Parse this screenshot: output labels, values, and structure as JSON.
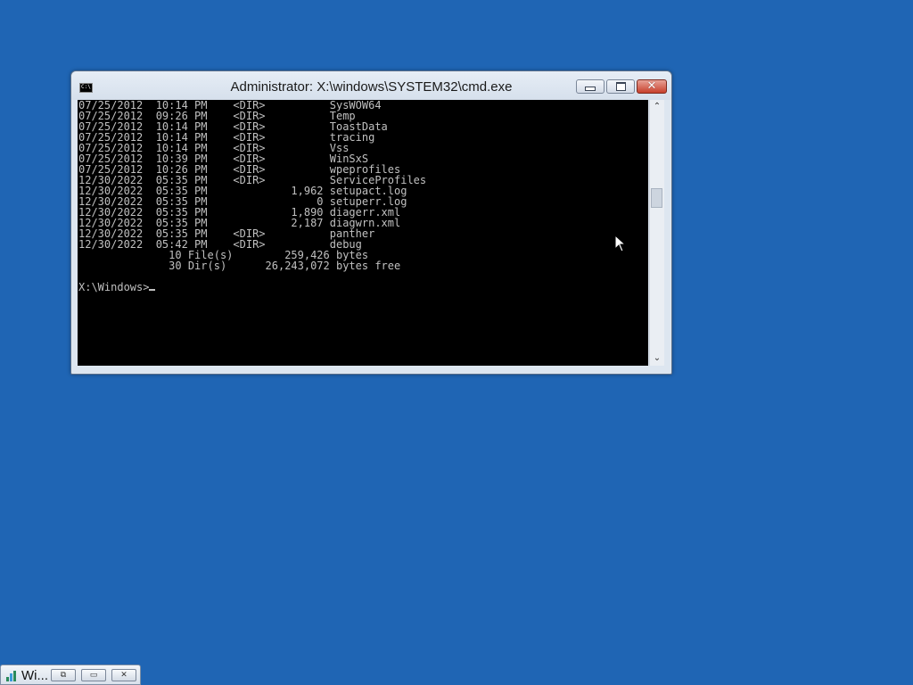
{
  "window": {
    "title": "Administrator: X:\\windows\\SYSTEM32\\cmd.exe",
    "icon_text": "C:\\",
    "buttons": {
      "minimize": "minimize-icon",
      "maximize": "maximize-icon",
      "close": "close-icon"
    }
  },
  "console": {
    "lines": [
      "07/25/2012  10:14 PM    <DIR>          SysWOW64",
      "07/25/2012  09:26 PM    <DIR>          Temp",
      "07/25/2012  10:14 PM    <DIR>          ToastData",
      "07/25/2012  10:14 PM    <DIR>          tracing",
      "07/25/2012  10:14 PM    <DIR>          Vss",
      "07/25/2012  10:39 PM    <DIR>          WinSxS",
      "07/25/2012  10:26 PM    <DIR>          wpeprofiles",
      "12/30/2022  05:35 PM    <DIR>          ServiceProfiles",
      "12/30/2022  05:35 PM             1,962 setupact.log",
      "12/30/2022  05:35 PM                 0 setuperr.log",
      "12/30/2022  05:35 PM             1,890 diagerr.xml",
      "12/30/2022  05:35 PM             2,187 diagwrn.xml",
      "12/30/2022  05:35 PM    <DIR>          panther",
      "12/30/2022  05:42 PM    <DIR>          debug",
      "              10 File(s)        259,426 bytes",
      "              30 Dir(s)      26,243,072 bytes free",
      ""
    ],
    "prompt": "X:\\Windows>"
  },
  "taskbar": {
    "item_label": "Wi...",
    "buttons": [
      "restore-icon",
      "maximize-icon",
      "close-icon"
    ]
  },
  "colors": {
    "desktop": "#1f65b4",
    "console_bg": "#000000",
    "console_fg": "#c0c0c0",
    "close_button": "#c7402c"
  }
}
